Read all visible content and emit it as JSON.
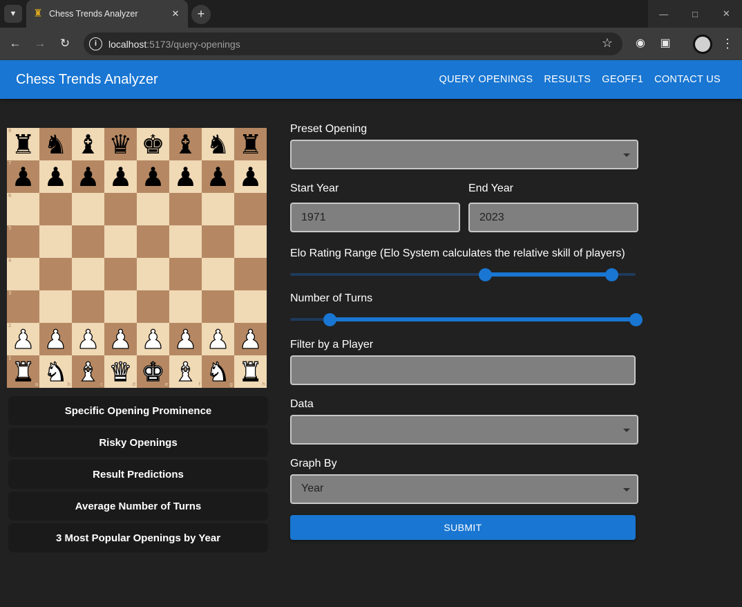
{
  "browser": {
    "tab_title": "Chess Trends Analyzer",
    "url_host": "localhost",
    "url_rest": ":5173/query-openings"
  },
  "app": {
    "title": "Chess Trends Analyzer",
    "nav": [
      "QUERY OPENINGS",
      "RESULTS",
      "GEOFF1",
      "CONTACT US"
    ]
  },
  "board": {
    "files": [
      "a",
      "b",
      "c",
      "d",
      "e",
      "f",
      "g",
      "h"
    ],
    "ranks": [
      "8",
      "7",
      "6",
      "5",
      "4",
      "3",
      "2",
      "1"
    ],
    "position": [
      [
        "r",
        "n",
        "b",
        "q",
        "k",
        "b",
        "n",
        "r"
      ],
      [
        "p",
        "p",
        "p",
        "p",
        "p",
        "p",
        "p",
        "p"
      ],
      [
        "",
        "",
        "",
        "",
        "",
        "",
        "",
        ""
      ],
      [
        "",
        "",
        "",
        "",
        "",
        "",
        "",
        ""
      ],
      [
        "",
        "",
        "",
        "",
        "",
        "",
        "",
        ""
      ],
      [
        "",
        "",
        "",
        "",
        "",
        "",
        "",
        ""
      ],
      [
        "P",
        "P",
        "P",
        "P",
        "P",
        "P",
        "P",
        "P"
      ],
      [
        "R",
        "N",
        "B",
        "Q",
        "K",
        "B",
        "N",
        "R"
      ]
    ]
  },
  "analysis_buttons": [
    "Specific Opening Prominence",
    "Risky Openings",
    "Result Predictions",
    "Average Number of Turns",
    "3 Most Popular Openings by Year"
  ],
  "form": {
    "preset_opening_label": "Preset Opening",
    "preset_opening_value": "",
    "start_year_label": "Start Year",
    "start_year_value": "1971",
    "end_year_label": "End Year",
    "end_year_value": "2023",
    "elo_label": "Elo Rating Range (Elo System calculates the relative skill of players)",
    "elo_range_fraction": [
      0.565,
      0.93
    ],
    "turns_label": "Number of Turns",
    "turns_range_fraction": [
      0.115,
      1.0
    ],
    "player_label": "Filter by a Player",
    "player_value": "",
    "data_label": "Data",
    "data_value": "",
    "graph_by_label": "Graph By",
    "graph_by_value": "Year",
    "submit_label": "SUBMIT"
  }
}
